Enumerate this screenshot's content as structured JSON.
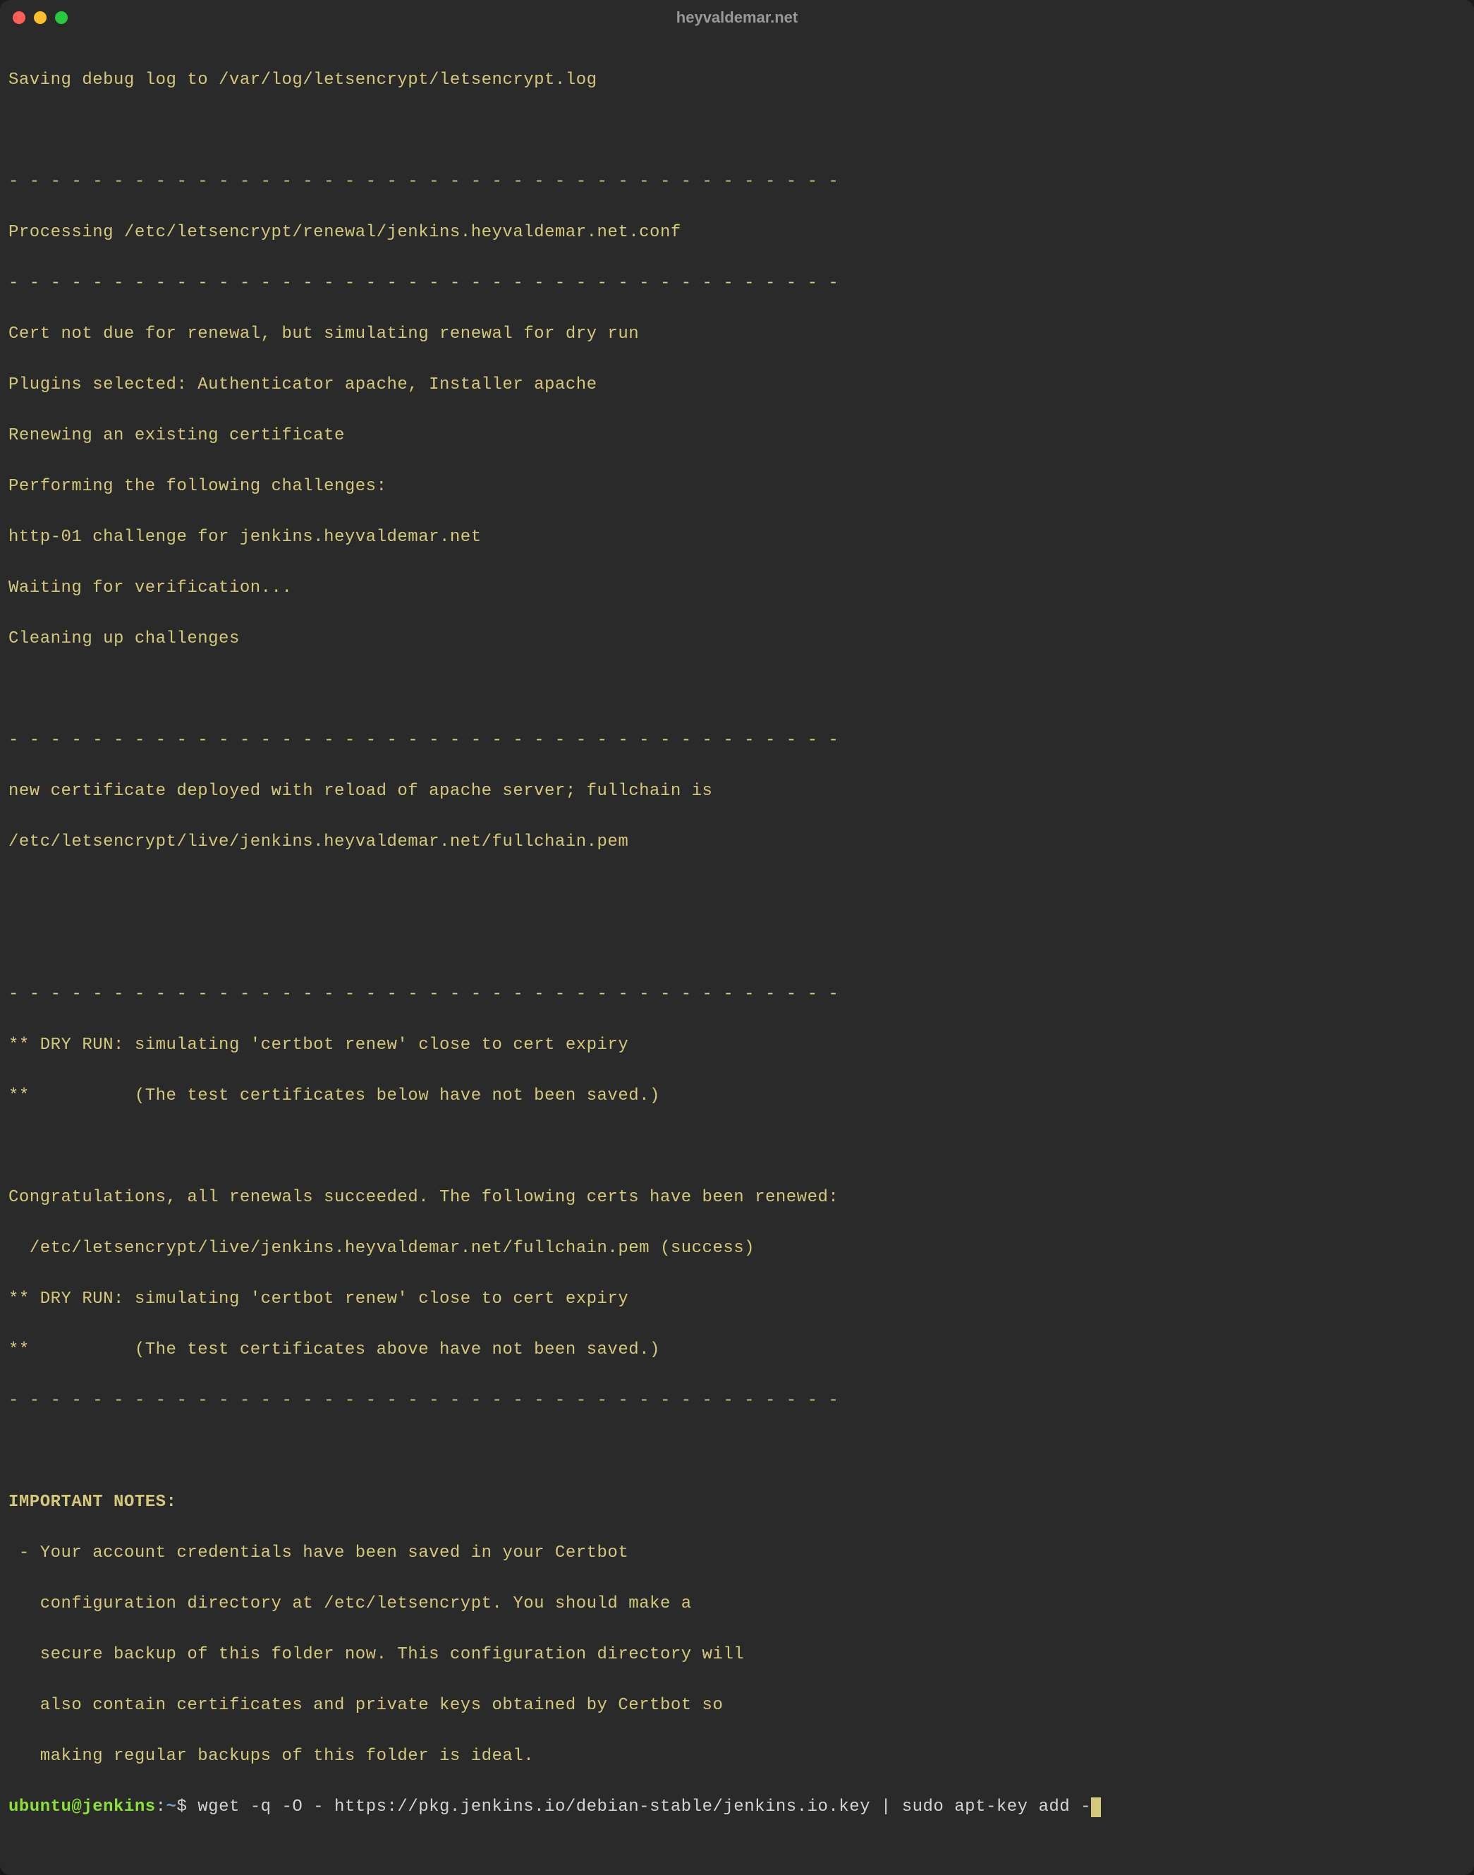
{
  "window": {
    "title": "heyvaldemar.net"
  },
  "terminal": {
    "lines": [
      "Saving debug log to /var/log/letsencrypt/letsencrypt.log",
      "",
      "- - - - - - - - - - - - - - - - - - - - - - - - - - - - - - - - - - - - - - - -",
      "Processing /etc/letsencrypt/renewal/jenkins.heyvaldemar.net.conf",
      "- - - - - - - - - - - - - - - - - - - - - - - - - - - - - - - - - - - - - - - -",
      "Cert not due for renewal, but simulating renewal for dry run",
      "Plugins selected: Authenticator apache, Installer apache",
      "Renewing an existing certificate",
      "Performing the following challenges:",
      "http-01 challenge for jenkins.heyvaldemar.net",
      "Waiting for verification...",
      "Cleaning up challenges",
      "",
      "- - - - - - - - - - - - - - - - - - - - - - - - - - - - - - - - - - - - - - - -",
      "new certificate deployed with reload of apache server; fullchain is",
      "/etc/letsencrypt/live/jenkins.heyvaldemar.net/fullchain.pem",
      "",
      "",
      "- - - - - - - - - - - - - - - - - - - - - - - - - - - - - - - - - - - - - - - -",
      "** DRY RUN: simulating 'certbot renew' close to cert expiry",
      "**          (The test certificates below have not been saved.)",
      "",
      "Congratulations, all renewals succeeded. The following certs have been renewed:",
      "  /etc/letsencrypt/live/jenkins.heyvaldemar.net/fullchain.pem (success)",
      "** DRY RUN: simulating 'certbot renew' close to cert expiry",
      "**          (The test certificates above have not been saved.)",
      "- - - - - - - - - - - - - - - - - - - - - - - - - - - - - - - - - - - - - - - -",
      ""
    ],
    "important_notes_header": "IMPORTANT NOTES:",
    "important_notes": [
      " - Your account credentials have been saved in your Certbot",
      "   configuration directory at /etc/letsencrypt. You should make a",
      "   secure backup of this folder now. This configuration directory will",
      "   also contain certificates and private keys obtained by Certbot so",
      "   making regular backups of this folder is ideal."
    ],
    "prompt": {
      "user_host": "ubuntu@jenkins",
      "colon": ":",
      "path": "~",
      "dollar": "$ ",
      "command": "wget -q -O - https://pkg.jenkins.io/debian-stable/jenkins.io.key | sudo apt-key add -"
    }
  }
}
